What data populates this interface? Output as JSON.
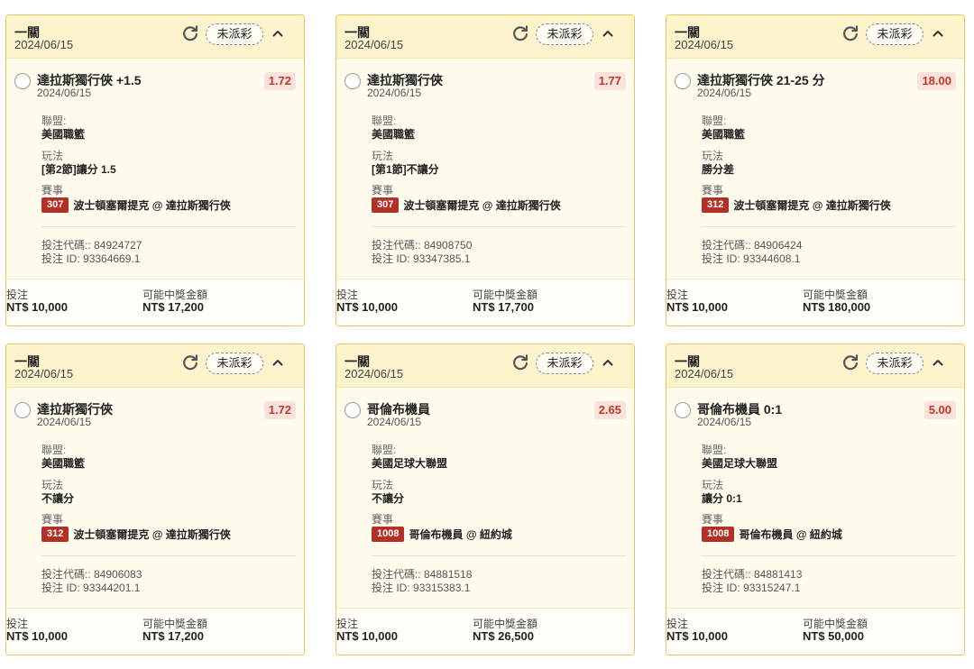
{
  "labels": {
    "league": "聯盟:",
    "play": "玩法",
    "event": "賽事",
    "bet_code": "投注代碼:",
    "bet_id": "投注 ID:",
    "stake": "投注",
    "payout": "可能中獎金額"
  },
  "cards": [
    {
      "title": "一關",
      "date": "2024/06/15",
      "status": "未派彩",
      "selection": "達拉斯獨行俠 +1.5",
      "selection_date": "2024/06/15",
      "odds": "1.72",
      "league": "美國職籃",
      "play": "[第2節]讓分 1.5",
      "event_no": "307",
      "event": "波士頓塞爾提克 @ 達拉斯獨行俠",
      "bet_code": ": 84924727",
      "bet_id": "93364669.1",
      "stake": "NT$ 10,000",
      "payout": "NT$ 17,200"
    },
    {
      "title": "一關",
      "date": "2024/06/15",
      "status": "未派彩",
      "selection": "達拉斯獨行俠",
      "selection_date": "2024/06/15",
      "odds": "1.77",
      "league": "美國職籃",
      "play": "[第1節]不讓分",
      "event_no": "307",
      "event": "波士頓塞爾提克 @ 達拉斯獨行俠",
      "bet_code": ": 84908750",
      "bet_id": "93347385.1",
      "stake": "NT$ 10,000",
      "payout": "NT$ 17,700"
    },
    {
      "title": "一關",
      "date": "2024/06/15",
      "status": "未派彩",
      "selection": "達拉斯獨行俠 21-25 分",
      "selection_date": "2024/06/15",
      "odds": "18.00",
      "league": "美國職籃",
      "play": "勝分差",
      "event_no": "312",
      "event": "波士頓塞爾提克 @ 達拉斯獨行俠",
      "bet_code": ": 84906424",
      "bet_id": "93344608.1",
      "stake": "NT$ 10,000",
      "payout": "NT$ 180,000"
    },
    {
      "title": "一關",
      "date": "2024/06/15",
      "status": "未派彩",
      "selection": "達拉斯獨行俠",
      "selection_date": "2024/06/15",
      "odds": "1.72",
      "league": "美國職籃",
      "play": "不讓分",
      "event_no": "312",
      "event": "波士頓塞爾提克 @ 達拉斯獨行俠",
      "bet_code": ": 84906083",
      "bet_id": "93344201.1",
      "stake": "NT$ 10,000",
      "payout": "NT$ 17,200"
    },
    {
      "title": "一關",
      "date": "2024/06/15",
      "status": "未派彩",
      "selection": "哥倫布機員",
      "selection_date": "2024/06/15",
      "odds": "2.65",
      "league": "美國足球大聯盟",
      "play": "不讓分",
      "event_no": "1008",
      "event": "哥倫布機員 @ 紐約城",
      "bet_code": ": 84881518",
      "bet_id": "93315383.1",
      "stake": "NT$ 10,000",
      "payout": "NT$ 26,500"
    },
    {
      "title": "一關",
      "date": "2024/06/15",
      "status": "未派彩",
      "selection": "哥倫布機員 0:1",
      "selection_date": "2024/06/15",
      "odds": "5.00",
      "league": "美國足球大聯盟",
      "play": "讓分 0:1",
      "event_no": "1008",
      "event": "哥倫布機員 @ 紐約城",
      "bet_code": ": 84881413",
      "bet_id": "93315247.1",
      "stake": "NT$ 10,000",
      "payout": "NT$ 50,000"
    }
  ]
}
